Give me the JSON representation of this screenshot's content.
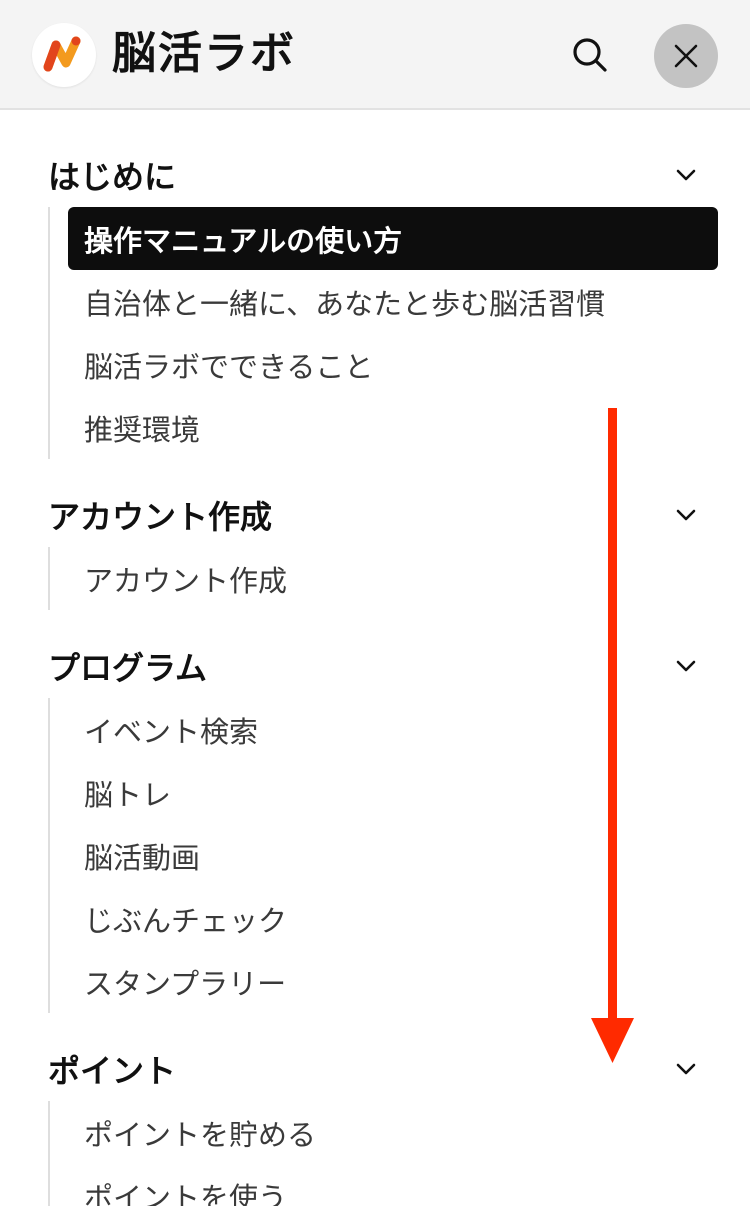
{
  "header": {
    "logo_text": "脳活ラボ",
    "logo_icon": "brain-lab-logo-icon",
    "search_icon": "search-icon",
    "close_icon": "close-icon"
  },
  "colors": {
    "header_bg": "#f4f4f4",
    "active_bg": "#0d0d0d",
    "close_bg": "#c3c3c3",
    "arrow": "#ff2a00",
    "logo_orange": "#f39a1e",
    "logo_red": "#e2451c"
  },
  "menu": {
    "sections": [
      {
        "title": "はじめに",
        "items": [
          {
            "label": "操作マニュアルの使い方",
            "active": true
          },
          {
            "label": "自治体と一緒に、あなたと歩む脳活習慣"
          },
          {
            "label": "脳活ラボでできること"
          },
          {
            "label": "推奨環境"
          }
        ]
      },
      {
        "title": "アカウント作成",
        "items": [
          {
            "label": "アカウント作成"
          }
        ]
      },
      {
        "title": "プログラム",
        "items": [
          {
            "label": "イベント検索"
          },
          {
            "label": "脳トレ"
          },
          {
            "label": "脳活動画"
          },
          {
            "label": "じぶんチェック"
          },
          {
            "label": "スタンプラリー"
          }
        ]
      },
      {
        "title": "ポイント",
        "items": [
          {
            "label": "ポイントを貯める"
          },
          {
            "label": "ポイントを使う"
          }
        ]
      }
    ]
  },
  "annotation": {
    "type": "scroll-down-arrow"
  }
}
